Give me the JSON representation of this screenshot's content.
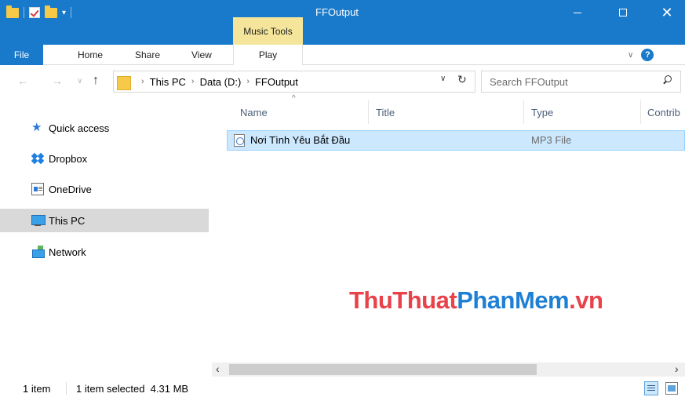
{
  "window": {
    "title": "FFOutput",
    "context_tab_group": "Music Tools"
  },
  "ribbon": {
    "tabs": [
      {
        "label": "File"
      },
      {
        "label": "Home"
      },
      {
        "label": "Share"
      },
      {
        "label": "View"
      },
      {
        "label": "Play"
      }
    ],
    "help_label": "?"
  },
  "address": {
    "breadcrumbs": [
      "This PC",
      "Data (D:)",
      "FFOutput"
    ],
    "search_placeholder": "Search FFOutput"
  },
  "nav": {
    "items": [
      {
        "label": "Quick access",
        "icon": "star-icon"
      },
      {
        "label": "Dropbox",
        "icon": "dropbox-icon"
      },
      {
        "label": "OneDrive",
        "icon": "onedrive-icon"
      },
      {
        "label": "This PC",
        "icon": "computer-icon",
        "selected": true
      },
      {
        "label": "Network",
        "icon": "network-icon"
      }
    ]
  },
  "filelist": {
    "columns": [
      "Name",
      "Title",
      "Type",
      "Contrib"
    ],
    "rows": [
      {
        "name": "Nơi Tình Yêu Bắt Đầu",
        "title": "",
        "type": "MP3 File",
        "selected": true
      }
    ]
  },
  "watermark": {
    "part1": "ThuThuat",
    "part2": "PhanMem",
    "part3": ".vn"
  },
  "status": {
    "item_count": "1 item",
    "selection": "1 item selected  4.31 MB"
  },
  "colors": {
    "titlebar": "#1979ca",
    "context_tab": "#f4e59a",
    "selection": "#cce8ff"
  }
}
